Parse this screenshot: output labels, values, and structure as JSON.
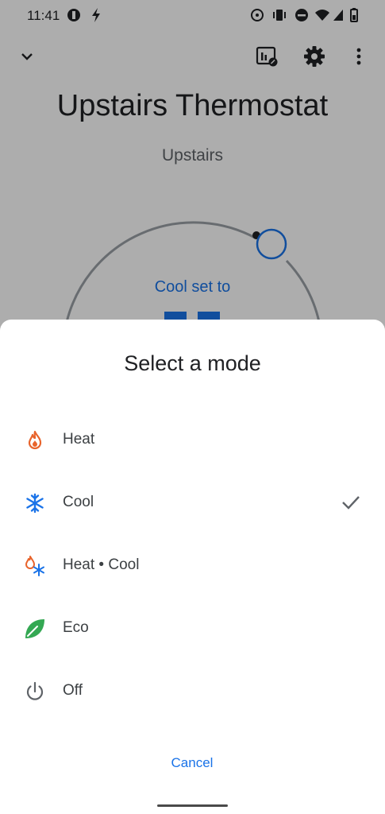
{
  "status_bar": {
    "time": "11:41"
  },
  "header": {
    "title": "Upstairs Thermostat",
    "subtitle": "Upstairs"
  },
  "dial": {
    "label": "Cool set to"
  },
  "sheet": {
    "title": "Select a mode",
    "options": [
      {
        "label": "Heat",
        "icon": "flame-icon",
        "selected": false
      },
      {
        "label": "Cool",
        "icon": "snowflake-icon",
        "selected": true
      },
      {
        "label": "Heat • Cool",
        "icon": "heat-cool-icon",
        "selected": false
      },
      {
        "label": "Eco",
        "icon": "leaf-icon",
        "selected": false
      },
      {
        "label": "Off",
        "icon": "power-icon",
        "selected": false
      }
    ],
    "cancel_label": "Cancel"
  },
  "colors": {
    "accent": "#1a73e8",
    "heat": "#e8642c",
    "eco": "#34a853",
    "text": "#3c4043"
  }
}
